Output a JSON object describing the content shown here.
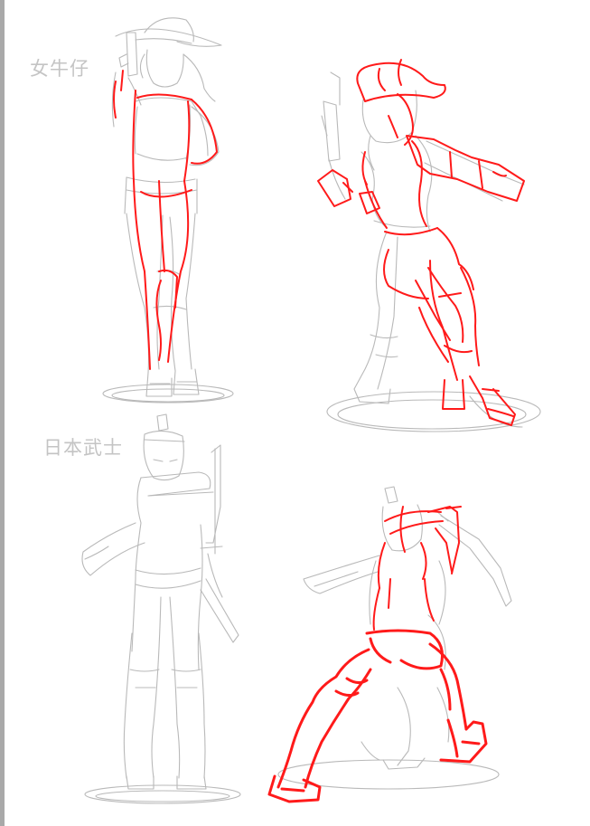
{
  "labels": {
    "cowgirl": "女牛仔",
    "samurai": "日本武士"
  },
  "colors": {
    "background": "#ffffff",
    "sketch_gray": "#b9b9b9",
    "gesture_red": "#ff1a1a",
    "label_gray": "#c4c4c4",
    "left_strip": "#a9a9a9"
  }
}
